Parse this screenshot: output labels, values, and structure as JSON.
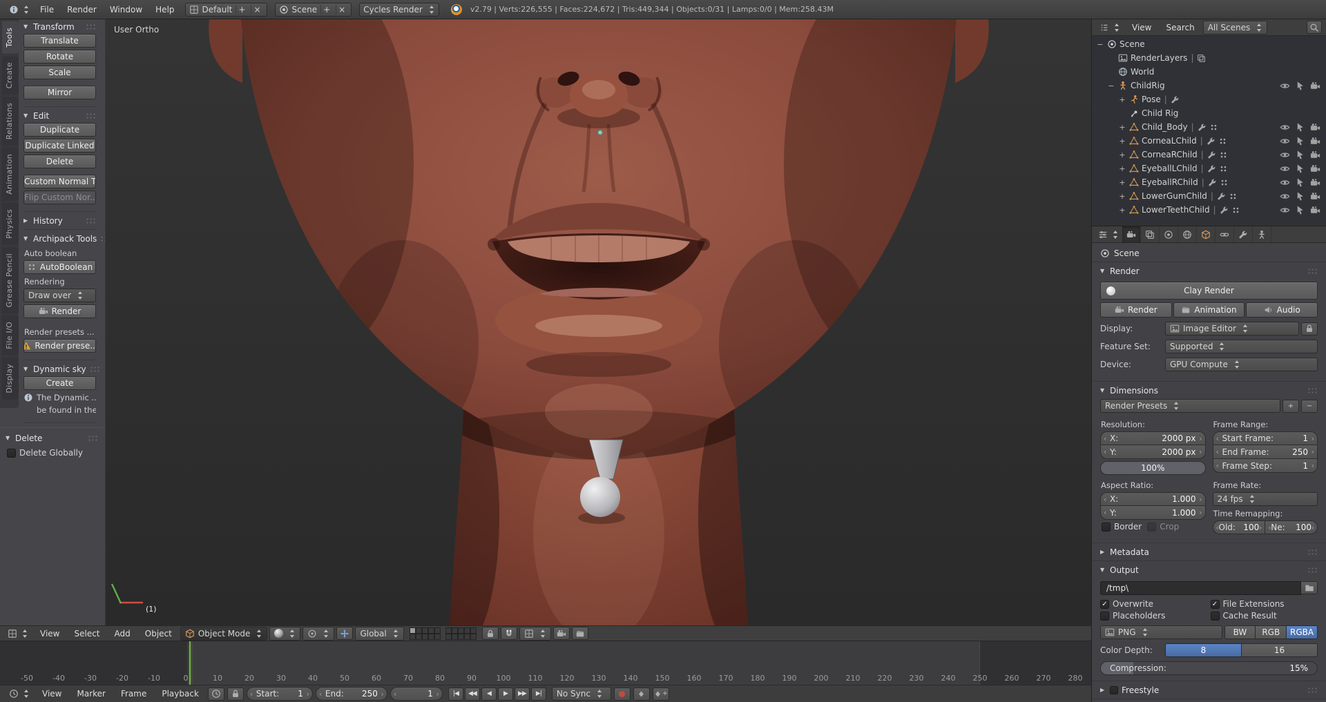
{
  "topbar": {
    "menus": [
      "File",
      "Render",
      "Window",
      "Help"
    ],
    "layout": "Default",
    "scene": "Scene",
    "engine": "Cycles Render",
    "stats": "v2.79 | Verts:226,555 | Faces:224,672 | Tris:449,344 | Objects:0/31 | Lamps:0/0 | Mem:258.43M"
  },
  "toolshelf": {
    "tabs": [
      "Tools",
      "Create",
      "Relations",
      "Animation",
      "Physics",
      "Grease Pencil",
      "File I/O",
      "Display"
    ],
    "transform": {
      "title": "Transform",
      "b0": "Translate",
      "b1": "Rotate",
      "b2": "Scale",
      "b3": "Mirror"
    },
    "edit": {
      "title": "Edit",
      "b0": "Duplicate",
      "b1": "Duplicate Linked",
      "b2": "Delete",
      "b3": "Custom Normal T...",
      "b4": "Flip Custom Nor..."
    },
    "history": {
      "title": "History"
    },
    "archipack": {
      "title": "Archipack Tools",
      "auto_boolean": "Auto boolean",
      "autoboolean_btn": "AutoBoolean",
      "rendering": "Rendering",
      "draw_over": "Draw over",
      "render_btn": "Render",
      "presets_label": "Render presets ...",
      "preset_btn": "Render prese..."
    },
    "dynamic_sky": {
      "title": "Dynamic sky",
      "create_btn": "Create",
      "info1": "The Dynamic ...",
      "info2": "be found in the..."
    },
    "redo": {
      "title": "Delete",
      "option": "Delete Globally"
    }
  },
  "viewport": {
    "view_label": "User Ortho",
    "frame_badge": "(1)",
    "menus": [
      "View",
      "Select",
      "Add",
      "Object"
    ],
    "mode": "Object Mode",
    "orientation": "Global"
  },
  "timeline": {
    "menus": [
      "View",
      "Marker",
      "Frame",
      "Playback"
    ],
    "start_label": "Start:",
    "start_value": "1",
    "end_label": "End:",
    "end_value": "250",
    "current_frame": "1",
    "sync_mode": "No Sync",
    "frame_start": 1,
    "frame_end": 250,
    "ticks": [
      -50,
      -40,
      -30,
      -20,
      -10,
      0,
      10,
      20,
      30,
      40,
      50,
      60,
      70,
      80,
      90,
      100,
      110,
      120,
      130,
      140,
      150,
      160,
      170,
      180,
      190,
      200,
      210,
      220,
      230,
      240,
      250,
      260,
      270,
      280
    ],
    "playback": [
      "jump-start",
      "prev-keyframe",
      "play-reverse",
      "play",
      "next-keyframe",
      "jump-end"
    ]
  },
  "outliner": {
    "menus": [
      "View",
      "Search"
    ],
    "scope": "All Scenes",
    "rows": [
      {
        "name": "Scene",
        "icon": "scene",
        "indent": 0,
        "toggle": "minus"
      },
      {
        "name": "RenderLayers",
        "icon": "image",
        "indent": 1,
        "sep": true,
        "extras": [
          "layers"
        ]
      },
      {
        "name": "World",
        "icon": "world",
        "indent": 1
      },
      {
        "name": "ChildRig",
        "icon": "armature",
        "indent": 1,
        "toggle": "minus",
        "right": [
          "eye",
          "cursor",
          "cam"
        ]
      },
      {
        "name": "Pose",
        "icon": "pose",
        "indent": 2,
        "toggle": "plus",
        "sep": true,
        "extras": [
          "wrench"
        ]
      },
      {
        "name": "Child Rig",
        "icon": "armdata",
        "indent": 2
      },
      {
        "name": "Child_Body",
        "icon": "mesh",
        "indent": 2,
        "toggle": "plus",
        "sep": true,
        "extras": [
          "wrench",
          "dots"
        ],
        "right": [
          "eye",
          "cursor",
          "cam"
        ]
      },
      {
        "name": "CorneaLChild",
        "icon": "mesh",
        "indent": 2,
        "toggle": "plus",
        "sep": true,
        "extras": [
          "wrench",
          "dots"
        ],
        "right": [
          "eye",
          "cursor",
          "cam"
        ]
      },
      {
        "name": "CorneaRChild",
        "icon": "mesh",
        "indent": 2,
        "toggle": "plus",
        "sep": true,
        "extras": [
          "wrench",
          "dots"
        ],
        "right": [
          "eye",
          "cursor",
          "cam"
        ]
      },
      {
        "name": "EyeballLChild",
        "icon": "mesh",
        "indent": 2,
        "toggle": "plus",
        "sep": true,
        "extras": [
          "wrench",
          "dots"
        ],
        "right": [
          "eye",
          "cursor",
          "cam"
        ]
      },
      {
        "name": "EyeballRChild",
        "icon": "mesh",
        "indent": 2,
        "toggle": "plus",
        "sep": true,
        "extras": [
          "wrench",
          "dots"
        ],
        "right": [
          "eye",
          "cursor",
          "cam"
        ]
      },
      {
        "name": "LowerGumChild",
        "icon": "mesh",
        "indent": 2,
        "toggle": "plus",
        "sep": true,
        "extras": [
          "wrench",
          "dots"
        ],
        "right": [
          "eye",
          "cursor",
          "cam"
        ]
      },
      {
        "name": "LowerTeethChild",
        "icon": "mesh",
        "indent": 2,
        "toggle": "plus",
        "sep": true,
        "extras": [
          "wrench",
          "dots"
        ],
        "right": [
          "eye",
          "cursor",
          "cam"
        ]
      }
    ]
  },
  "properties": {
    "tabs": [
      "render",
      "render-layers",
      "scene",
      "world",
      "object",
      "constraints",
      "modifiers",
      "object-data"
    ],
    "breadcrumb": "Scene",
    "render": {
      "title": "Render",
      "clay": "Clay Render",
      "render": "Render",
      "animation": "Animation",
      "audio": "Audio",
      "display_label": "Display:",
      "display": "Image Editor",
      "feature_label": "Feature Set:",
      "feature": "Supported",
      "device_label": "Device:",
      "device": "GPU Compute"
    },
    "dimensions": {
      "title": "Dimensions",
      "presets": "Render Presets",
      "resolution_label": "Resolution:",
      "res_x": "X:",
      "res_x_val": "2000 px",
      "res_y": "Y:",
      "res_y_val": "2000 px",
      "res_pct": "100%",
      "range_label": "Frame Range:",
      "start": "Start Frame:",
      "start_val": "1",
      "end": "End Frame:",
      "end_val": "250",
      "step": "Frame Step:",
      "step_val": "1",
      "aspect_label": "Aspect Ratio:",
      "asp_x": "X:",
      "asp_x_val": "1.000",
      "asp_y": "Y:",
      "asp_y_val": "1.000",
      "rate_label": "Frame Rate:",
      "fps": "24 fps",
      "remap_label": "Time Remapping:",
      "old": "Old:",
      "old_val": "100",
      "new": "Ne:",
      "new_val": "100",
      "border": "Border",
      "crop": "Crop"
    },
    "metadata": {
      "title": "Metadata"
    },
    "output": {
      "title": "Output",
      "path": "/tmp\\",
      "overwrite": "Overwrite",
      "extensions": "File Extensions",
      "placeholders": "Placeholders",
      "cache": "Cache Result",
      "format": "PNG",
      "bw": "BW",
      "rgb": "RGB",
      "rgba": "RGBA",
      "depth_label": "Color Depth:",
      "d8": "8",
      "d16": "16",
      "compression_label": "Compression:",
      "compression_val": "15%"
    },
    "freestyle": {
      "title": "Freestyle"
    }
  }
}
